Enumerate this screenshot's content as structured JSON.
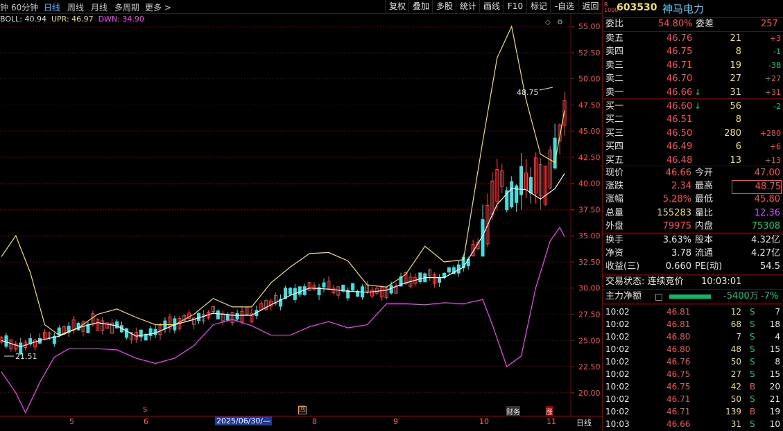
{
  "toolbar": {
    "periods": [
      "钟",
      "60分钟",
      "日线",
      "周线",
      "月线",
      "多周期",
      "更多 >"
    ],
    "active_period": "日线",
    "tools": [
      "复权",
      "叠加",
      "多股",
      "统计",
      "画线",
      "F10",
      "标记",
      "-自选",
      "返回"
    ]
  },
  "indicator": {
    "name": "BOLL: 40.94",
    "upr_label": "UPR: 46.97",
    "dwn_label": "DWN: 34.90",
    "colors": {
      "mid": "#ffffff",
      "upr": "#f0e060",
      "dwn": "#ff40ff"
    }
  },
  "chart_data": {
    "type": "candlestick",
    "y_ticks": [
      "55.00",
      "52.50",
      "50.00",
      "47.50",
      "45.00",
      "42.50",
      "40.00",
      "37.50",
      "35.00",
      "32.50",
      "30.00",
      "27.50",
      "25.00",
      "22.50",
      "20.00"
    ],
    "ylim": [
      17.8,
      56.2
    ],
    "annotations": {
      "high_label": "48.75",
      "low_label": "21.51"
    },
    "date_labels": [
      "5",
      "6",
      "2025/06/30/—",
      "8",
      "9",
      "10",
      "11"
    ],
    "period_label": "日线",
    "markers": [
      "S",
      "回",
      "财务",
      "涨"
    ],
    "upr": [
      [
        0,
        33
      ],
      [
        3,
        35
      ],
      [
        6,
        31.5
      ],
      [
        9,
        26.5
      ],
      [
        12,
        25.5
      ],
      [
        16,
        26.2
      ],
      [
        20,
        27.5
      ],
      [
        24,
        28
      ],
      [
        28,
        27.2
      ],
      [
        32,
        26.5
      ],
      [
        36,
        26.5
      ],
      [
        40,
        27.5
      ],
      [
        44,
        29
      ],
      [
        48,
        28.2
      ],
      [
        52,
        28.2
      ],
      [
        56,
        30.5
      ],
      [
        60,
        32
      ],
      [
        64,
        33.3
      ],
      [
        68,
        33.4
      ],
      [
        72,
        32.6
      ],
      [
        76,
        30.3
      ],
      [
        80,
        30.1
      ],
      [
        84,
        31.3
      ],
      [
        88,
        34
      ],
      [
        92,
        32.5
      ],
      [
        96,
        32.7
      ],
      [
        100,
        44
      ],
      [
        103,
        52
      ],
      [
        106,
        55
      ],
      [
        109,
        48
      ],
      [
        112,
        42.8
      ],
      [
        115,
        42
      ],
      [
        117,
        46.97
      ]
    ],
    "mid": [
      [
        0,
        25
      ],
      [
        4,
        24.4
      ],
      [
        8,
        25
      ],
      [
        12,
        25.4
      ],
      [
        16,
        26.2
      ],
      [
        20,
        26.7
      ],
      [
        24,
        26.4
      ],
      [
        28,
        25.4
      ],
      [
        32,
        25.7
      ],
      [
        36,
        26.5
      ],
      [
        40,
        27
      ],
      [
        44,
        27.6
      ],
      [
        48,
        27.4
      ],
      [
        52,
        27.4
      ],
      [
        56,
        28.4
      ],
      [
        60,
        29.3
      ],
      [
        64,
        30
      ],
      [
        68,
        29.9
      ],
      [
        72,
        29.7
      ],
      [
        76,
        29.6
      ],
      [
        80,
        29.8
      ],
      [
        84,
        30.5
      ],
      [
        88,
        31
      ],
      [
        92,
        31
      ],
      [
        96,
        32
      ],
      [
        100,
        35
      ],
      [
        103,
        38
      ],
      [
        106,
        39.5
      ],
      [
        109,
        39.4
      ],
      [
        112,
        38.5
      ],
      [
        115,
        39.5
      ],
      [
        117,
        40.94
      ]
    ],
    "dwn": [
      [
        0,
        22
      ],
      [
        3,
        20
      ],
      [
        5,
        18.1
      ],
      [
        8,
        21
      ],
      [
        11,
        23.4
      ],
      [
        14,
        24.2
      ],
      [
        17,
        24.2
      ],
      [
        20,
        24.2
      ],
      [
        24,
        24.1
      ],
      [
        28,
        23.3
      ],
      [
        32,
        22.8
      ],
      [
        36,
        23.3
      ],
      [
        40,
        24.5
      ],
      [
        44,
        26.5
      ],
      [
        48,
        27
      ],
      [
        52,
        26.4
      ],
      [
        56,
        25.5
      ],
      [
        60,
        25.5
      ],
      [
        64,
        26.3
      ],
      [
        68,
        26.8
      ],
      [
        72,
        26.2
      ],
      [
        76,
        26.5
      ],
      [
        80,
        28.5
      ],
      [
        84,
        28.5
      ],
      [
        88,
        28.4
      ],
      [
        92,
        28.6
      ],
      [
        96,
        28.5
      ],
      [
        100,
        28.9
      ],
      [
        102,
        26.5
      ],
      [
        105,
        22.5
      ],
      [
        108,
        23.5
      ],
      [
        111,
        30
      ],
      [
        114,
        34.5
      ],
      [
        116,
        35.8
      ],
      [
        117,
        34.9
      ]
    ],
    "candles_note": "daily candlesticks, last close 46.66"
  },
  "quote": {
    "code": "603530",
    "name": "神马电力",
    "weibi": {
      "label": "委比",
      "value": "54.80%",
      "diff_label": "委差",
      "diff": "257"
    },
    "asks": [
      {
        "label": "卖五",
        "price": "46.76",
        "vol": "21",
        "chg": "+3"
      },
      {
        "label": "卖四",
        "price": "46.75",
        "vol": "8",
        "chg": "-1"
      },
      {
        "label": "卖三",
        "price": "46.71",
        "vol": "19",
        "chg": "-38"
      },
      {
        "label": "卖二",
        "price": "46.70",
        "vol": "27",
        "chg": "+27"
      },
      {
        "label": "卖一",
        "price": "46.66",
        "vol": "31",
        "chg": "+31"
      }
    ],
    "bids": [
      {
        "label": "买一",
        "price": "46.60",
        "vol": "56",
        "chg": "-2"
      },
      {
        "label": "买二",
        "price": "46.51",
        "vol": "8",
        "chg": ""
      },
      {
        "label": "买三",
        "price": "46.50",
        "vol": "280",
        "chg": "+280"
      },
      {
        "label": "买四",
        "price": "46.49",
        "vol": "6",
        "chg": "+6"
      },
      {
        "label": "买五",
        "price": "46.48",
        "vol": "13",
        "chg": "+13"
      }
    ],
    "stats": [
      {
        "l1": "现价",
        "v1": "46.66",
        "c1": "red",
        "l2": "今开",
        "v2": "47.00",
        "c2": "red"
      },
      {
        "l1": "涨跌",
        "v1": "2.34",
        "c1": "red",
        "l2": "最高",
        "v2": "48.75",
        "c2": "red"
      },
      {
        "l1": "涨幅",
        "v1": "5.28%",
        "c1": "red",
        "l2": "最低",
        "v2": "45.80",
        "c2": "red"
      },
      {
        "l1": "总量",
        "v1": "155283",
        "c1": "yellow",
        "l2": "量比",
        "v2": "12.36",
        "c2": "mag"
      },
      {
        "l1": "外盘",
        "v1": "79975",
        "c1": "red",
        "l2": "内盘",
        "v2": "75308",
        "c2": "green"
      }
    ],
    "stats2": [
      {
        "l1": "换手",
        "v1": "3.63%",
        "l2": "股本",
        "v2": "4.32亿"
      },
      {
        "l1": "净资",
        "v1": "3.78",
        "l2": "流通",
        "v2": "4.27亿"
      },
      {
        "l1": "收益(三)",
        "v1": "0.660",
        "l2": "PE(动)",
        "v2": "54.5"
      }
    ],
    "status": {
      "label": "交易状态: 连续竞价",
      "time": "10:03:01"
    },
    "main_flow": {
      "label": "主力净额",
      "value": "-5400万",
      "pct": "-7%"
    },
    "ticks": [
      {
        "t": "10:02",
        "p": "46.81",
        "v": "12",
        "s": "S",
        "n": "7"
      },
      {
        "t": "10:02",
        "p": "46.81",
        "v": "68",
        "s": "S",
        "n": "18"
      },
      {
        "t": "10:02",
        "p": "46.80",
        "v": "7",
        "s": "S",
        "n": "4"
      },
      {
        "t": "10:02",
        "p": "46.80",
        "v": "48",
        "s": "S",
        "n": "15"
      },
      {
        "t": "10:02",
        "p": "46.76",
        "v": "50",
        "s": "S",
        "n": "8"
      },
      {
        "t": "10:02",
        "p": "46.75",
        "v": "27",
        "s": "S",
        "n": "15"
      },
      {
        "t": "10:02",
        "p": "46.75",
        "v": "42",
        "s": "B",
        "n": "20"
      },
      {
        "t": "10:02",
        "p": "46.71",
        "v": "50",
        "s": "S",
        "n": "21"
      },
      {
        "t": "10:02",
        "p": "46.71",
        "v": "139",
        "s": "B",
        "n": "19"
      },
      {
        "t": "10:03",
        "p": "46.66",
        "v": "31",
        "s": "S",
        "n": "10"
      }
    ]
  }
}
